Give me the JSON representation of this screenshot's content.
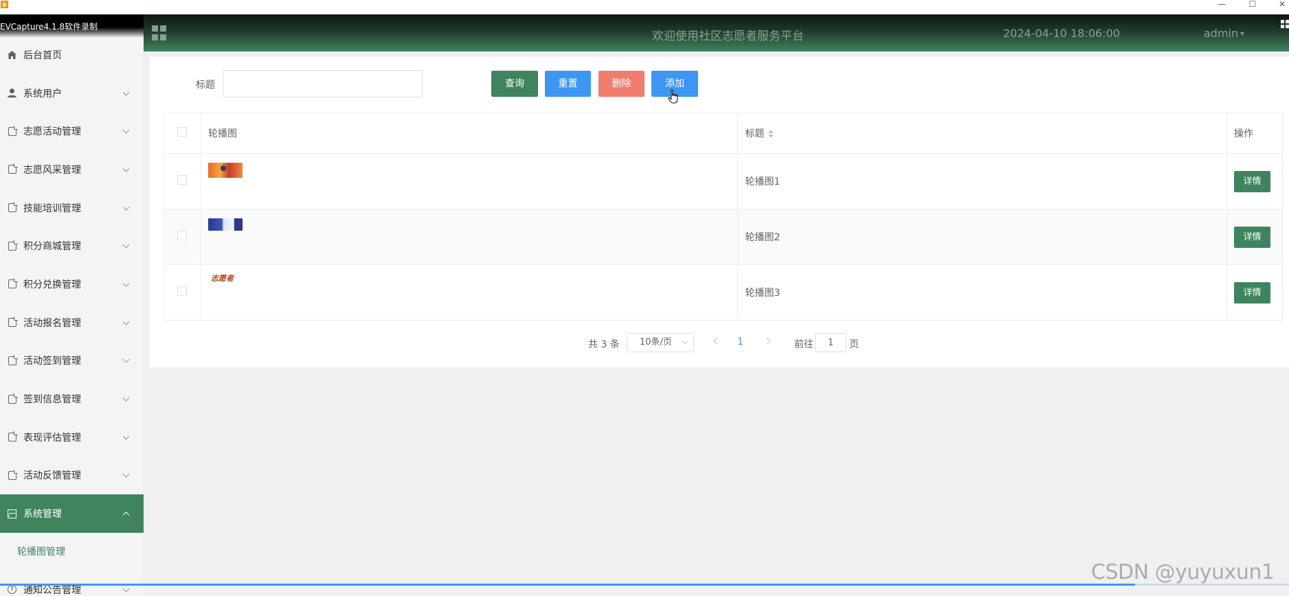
{
  "os": {
    "minimize": "—",
    "maximize": "☐",
    "close": "✕"
  },
  "recorder": {
    "label": "EVCapture4.1.8软件录制"
  },
  "sidebar": {
    "items": [
      {
        "label": "后台首页",
        "icon": "home-icon"
      },
      {
        "label": "系统用户",
        "icon": "user-icon"
      },
      {
        "label": "志愿活动管理",
        "icon": "document-icon"
      },
      {
        "label": "志愿风采管理",
        "icon": "document-icon"
      },
      {
        "label": "技能培训管理",
        "icon": "document-icon"
      },
      {
        "label": "积分商城管理",
        "icon": "document-icon"
      },
      {
        "label": "积分兑换管理",
        "icon": "document-icon"
      },
      {
        "label": "活动报名管理",
        "icon": "document-icon"
      },
      {
        "label": "活动签到管理",
        "icon": "document-icon"
      },
      {
        "label": "签到信息管理",
        "icon": "document-icon"
      },
      {
        "label": "表现评估管理",
        "icon": "document-icon"
      },
      {
        "label": "活动反馈管理",
        "icon": "document-icon"
      },
      {
        "label": "系统管理",
        "icon": "picture-icon"
      }
    ],
    "submenu": {
      "label": "轮播图管理"
    },
    "last_item": {
      "label": "通知公告管理",
      "icon": "info-icon"
    }
  },
  "header": {
    "title": "欢迎使用社区志愿者服务平台",
    "datetime": "2024-04-10 18:06:00",
    "user": "admin"
  },
  "search": {
    "label": "标题",
    "placeholder": "",
    "value": ""
  },
  "buttons": {
    "query": "查询",
    "reset": "重置",
    "delete": "删除",
    "add": "添加"
  },
  "table": {
    "columns": {
      "image": "轮播图",
      "title": "标题",
      "action": "操作"
    },
    "rows": [
      {
        "title": "轮播图1",
        "action": "详情",
        "thumb_text": ""
      },
      {
        "title": "轮播图2",
        "action": "详情",
        "thumb_text": ""
      },
      {
        "title": "轮播图3",
        "action": "详情",
        "thumb_text": "志愿者"
      }
    ]
  },
  "pagination": {
    "total": "共 3 条",
    "page_size": "10条/页",
    "current_page": "1",
    "goto_label": "前往",
    "goto_value": "1",
    "page_suffix": "页"
  },
  "watermark": "CSDN @yuyuxun1",
  "colors": {
    "primary_green": "#3f845f",
    "primary_blue": "#3d97f2",
    "danger": "#f07d6f"
  }
}
